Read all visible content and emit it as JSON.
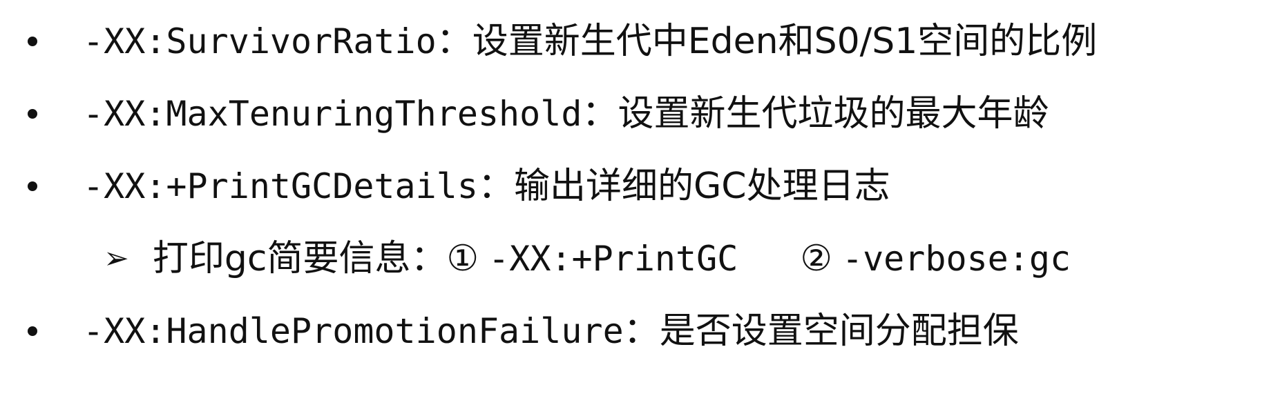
{
  "slide": {
    "items": [
      {
        "option": "-XX:SurvivorRatio",
        "sep": "：",
        "desc": "设置新生代中Eden和S0/S1空间的比例"
      },
      {
        "option": "-XX:MaxTenuringThreshold",
        "sep": "：",
        "desc": "设置新生代垃圾的最大年龄"
      },
      {
        "option": "-XX:+PrintGCDetails",
        "sep": "：",
        "desc": "输出详细的GC处理日志"
      },
      {
        "option": "-XX:HandlePromotionFailure",
        "sep": "：",
        "desc": "是否设置空间分配担保"
      }
    ],
    "sub_item": {
      "arrow": "➢",
      "label": "打印gc简要信息：",
      "opt1_num": "①",
      "opt1": "-XX:+PrintGC",
      "opt2_num": "②",
      "opt2": "-verbose:gc"
    }
  }
}
